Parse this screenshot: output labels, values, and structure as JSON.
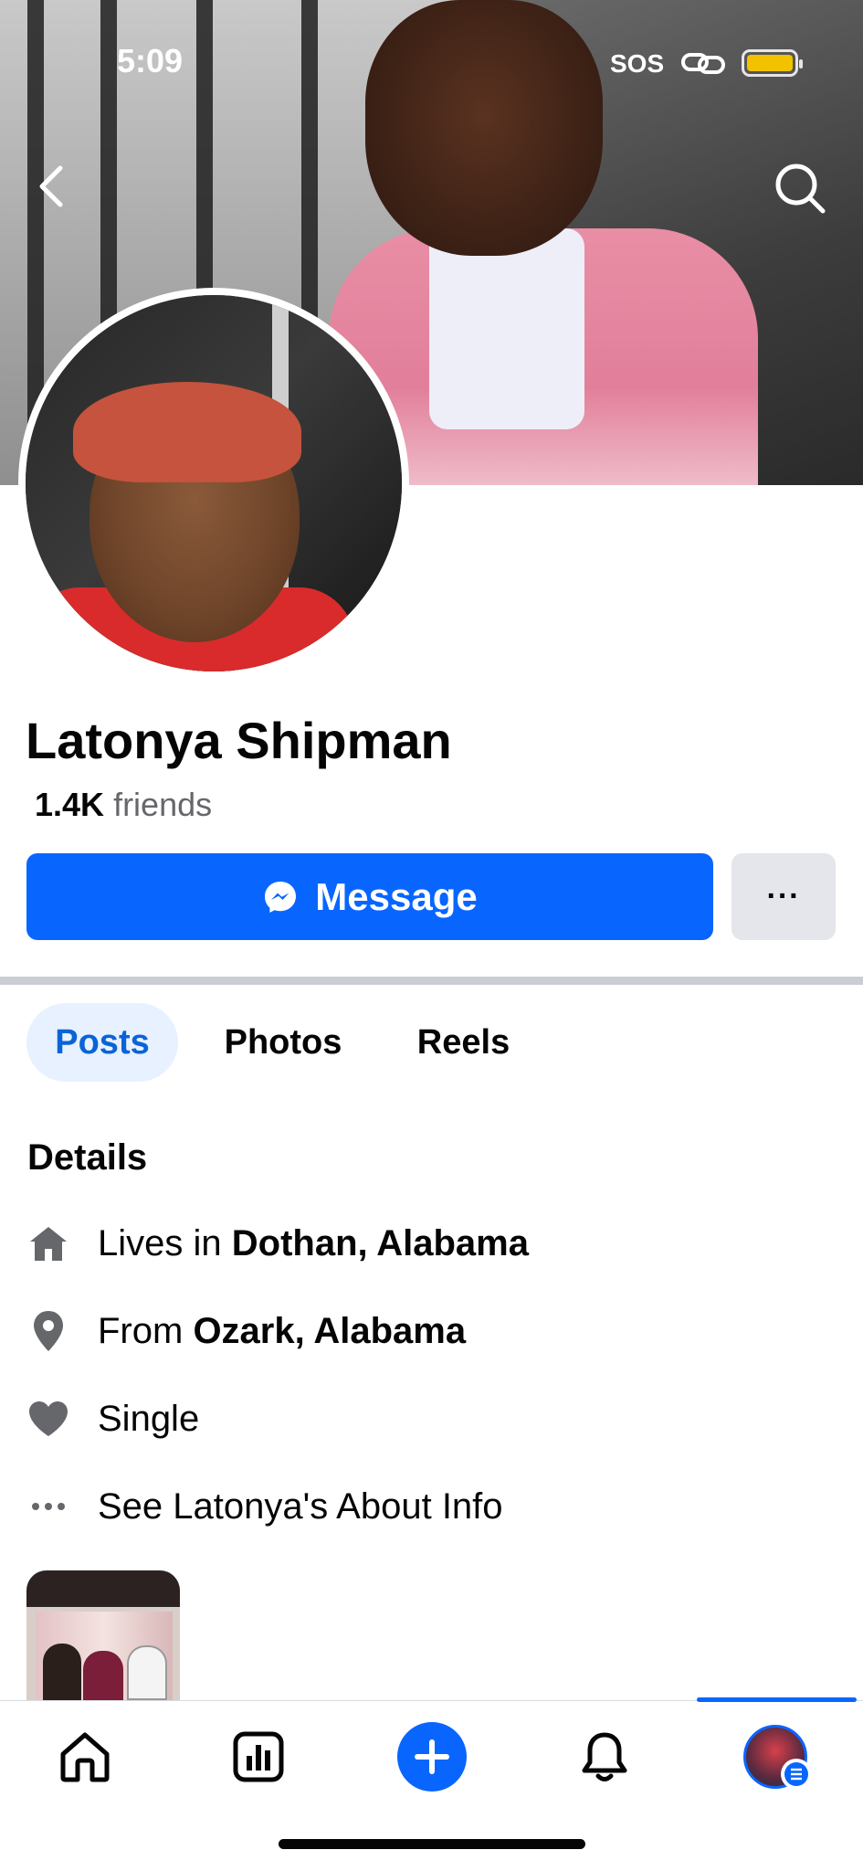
{
  "status_bar": {
    "time": "5:09",
    "sos": "SOS"
  },
  "header": {
    "back_icon": "chevron-left-icon",
    "search_icon": "search-icon"
  },
  "profile": {
    "name": "Latonya Shipman",
    "friends_count": "1.4K",
    "friends_label": "friends"
  },
  "actions": {
    "message_label": "Message",
    "message_icon": "messenger-icon",
    "more_label": "···"
  },
  "tabs": [
    {
      "label": "Posts",
      "active": true
    },
    {
      "label": "Photos",
      "active": false
    },
    {
      "label": "Reels",
      "active": false
    }
  ],
  "details": {
    "heading": "Details",
    "lives_prefix": "Lives in ",
    "lives_value": "Dothan, Alabama",
    "from_prefix": "From ",
    "from_value": "Ozark, Alabama",
    "relationship": "Single",
    "about_link": "See Latonya's About Info"
  },
  "bottom_nav": {
    "items": [
      "home-icon",
      "dashboard-icon",
      "create-plus-icon",
      "bell-icon",
      "profile-avatar"
    ],
    "active": "profile-avatar"
  },
  "colors": {
    "accent": "#0866ff",
    "tab_active_bg": "#e7f1ff",
    "secondary_button": "#e4e6eb",
    "muted_text": "#65676b"
  }
}
